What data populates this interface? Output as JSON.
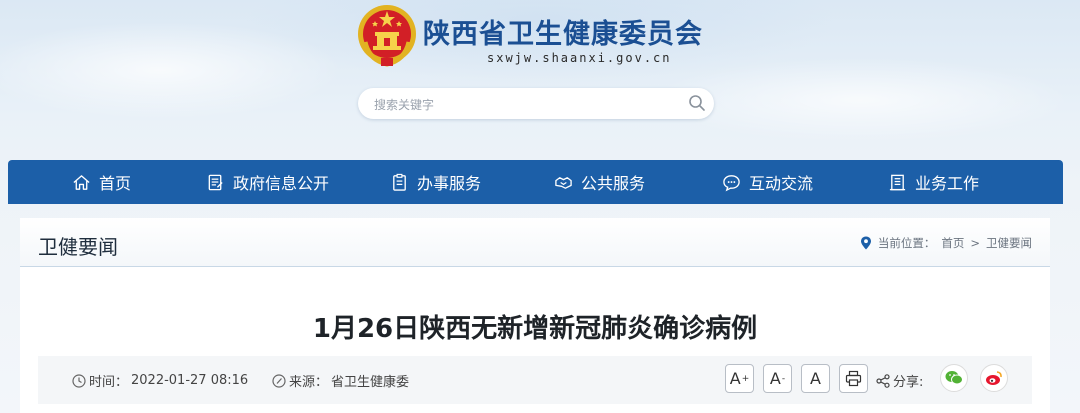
{
  "header": {
    "site_name": "陕西省卫生健康委员会",
    "site_url": "sxwjw.shaanxi.gov.cn",
    "search_placeholder": "搜索关键字"
  },
  "nav": {
    "items": [
      {
        "label": "首页",
        "icon": "home-icon"
      },
      {
        "label": "政府信息公开",
        "icon": "document-icon"
      },
      {
        "label": "办事服务",
        "icon": "clipboard-icon"
      },
      {
        "label": "公共服务",
        "icon": "handshake-icon"
      },
      {
        "label": "互动交流",
        "icon": "chat-icon"
      },
      {
        "label": "业务工作",
        "icon": "building-icon"
      }
    ]
  },
  "section": {
    "title": "卫健要闻",
    "breadcrumb_prefix": "当前位置：",
    "breadcrumb_home": "首页",
    "breadcrumb_separator": ">",
    "breadcrumb_current": "卫健要闻"
  },
  "article": {
    "title": "1月26日陕西无新增新冠肺炎确诊病例",
    "time_label": "时间：",
    "time_value": "2022-01-27 08:16",
    "source_label": "来源：",
    "source_value": "省卫生健康委",
    "font_larger": "A",
    "font_smaller": "A",
    "font_default": "A",
    "share_label": "分享:"
  },
  "colors": {
    "nav_bg": "#1c5fa8",
    "site_name": "#1b4f93",
    "wechat": "#52b235",
    "weibo": "#e6162d"
  }
}
